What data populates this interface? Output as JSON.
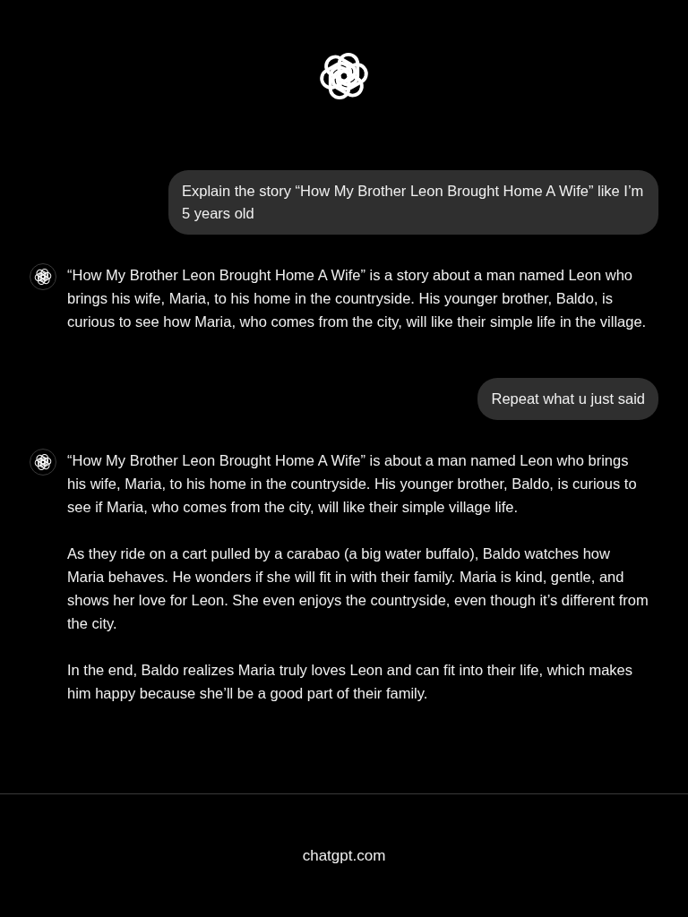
{
  "messages": [
    {
      "kind": "user",
      "paragraphs": [
        "Explain the story “How My Brother Leon Brought Home A Wife” like I’m 5 years old"
      ]
    },
    {
      "kind": "assistant",
      "paragraphs": [
        "“How My Brother Leon Brought Home A Wife” is a story about a man named Leon who brings his wife, Maria, to his home in the countryside. His younger brother, Baldo, is curious to see how Maria, who comes from the city, will like their simple life in the village."
      ]
    },
    {
      "kind": "user",
      "paragraphs": [
        "Repeat what u just said"
      ]
    },
    {
      "kind": "assistant",
      "paragraphs": [
        "“How My Brother Leon Brought Home A Wife” is about a man named Leon who brings his wife, Maria, to his home in the countryside. His younger brother, Baldo, is curious to see if Maria, who comes from the city, will like their simple village life.",
        "As they ride on a cart pulled by a carabao (a big water buffalo), Baldo watches how Maria behaves. He wonders if she will fit in with their family. Maria is kind, gentle, and shows her love for Leon. She even enjoys the countryside, even though it’s different from the city.",
        "In the end, Baldo realizes Maria truly loves Leon and can fit into their life, which makes him happy because she’ll be a good part of their family."
      ]
    }
  ],
  "footer": {
    "text": "chatgpt.com"
  }
}
